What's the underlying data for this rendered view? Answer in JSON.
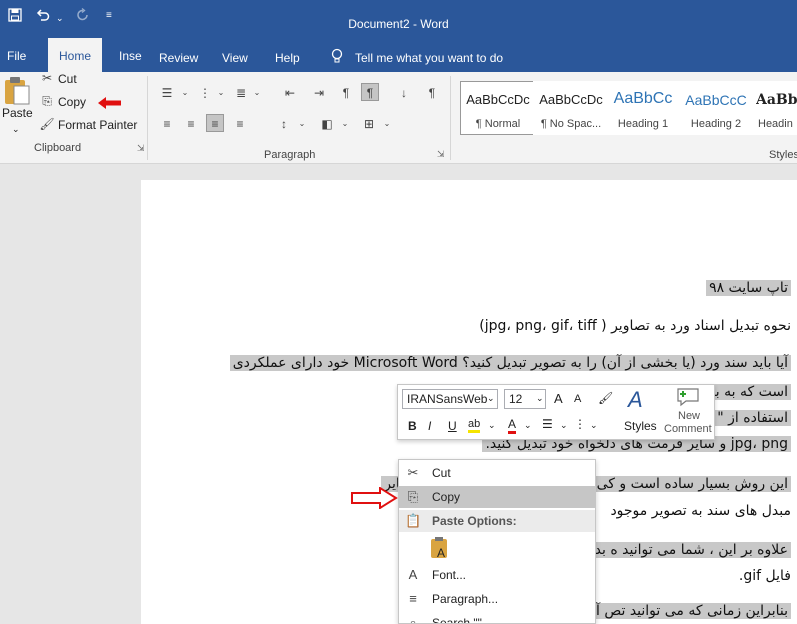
{
  "window": {
    "title": "Document2  -  Word"
  },
  "tabs": {
    "file": "File",
    "home": "Home",
    "insert": "Inse",
    "review": "Review",
    "view": "View",
    "help": "Help",
    "tell_me": "Tell me what you want to do"
  },
  "clipboard": {
    "paste": "Paste",
    "cut": "Cut",
    "copy": "Copy",
    "format_painter": "Format Painter",
    "group_label": "Clipboard"
  },
  "paragraph": {
    "group_label": "Paragraph"
  },
  "styles": {
    "group_label": "Styles",
    "items": [
      {
        "preview": "AaBbCcDc",
        "label": "¶ Normal"
      },
      {
        "preview": "AaBbCcDc",
        "label": "¶ No Spac..."
      },
      {
        "preview": "AaBbCc",
        "label": "Heading 1"
      },
      {
        "preview": "AaBbCcC",
        "label": "Heading 2"
      },
      {
        "preview": "AaBb",
        "label": "Headin"
      }
    ]
  },
  "document": {
    "lines": [
      "تاپ سایت ۹۸",
      "نحوه تبدیل اسناد ورد به تصاویر ( jpg، png، gif، tiff)",
      "آیا باید سند ورد (یا بخشی از آن) را به تصویر تبدیل کنید؟ Microsoft Word خود دارای عملکردی",
      "است که به                                              به شما اجازه می دهد تا اسناد را با",
      "استفاده از \"                                           را خواهید داشت که به فرمت های",
      "jpg، png و سایر فرمت های دلخواه خود تبدیل کنید.",
      "این روش بسیار ساده است و کی                  رایانه می دهد که بسیار بهتر از سایر",
      "مبدل های سند به تصویر موجود",
      "علاوه بر این ، شما می توانید ه                  بدیل کنید:  jpg، tiff، png یا فرمت",
      "فایل gif.",
      "بنابراین زمانی که می توانید تص                 آسان زیر ایجاد کنید ، هدر دادن"
    ]
  },
  "mini_toolbar": {
    "font": "IRANSansWeb",
    "size": "12",
    "bold": "B",
    "italic": "I",
    "underline": "U",
    "styles": "Styles",
    "new_comment_1": "New",
    "new_comment_2": "Comment"
  },
  "context_menu": {
    "cut": "Cut",
    "copy": "Copy",
    "paste_options": "Paste Options:",
    "font": "Font...",
    "paragraph": "Paragraph...",
    "search": "Search \"\""
  },
  "colors": {
    "accent": "#2b579a",
    "selection": "#c8c8c8",
    "annotation": "#e01010"
  }
}
